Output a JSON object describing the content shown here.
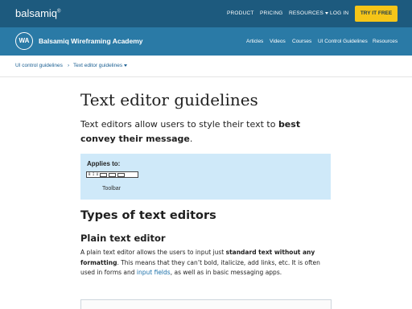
{
  "top_nav": {
    "brand": "balsamiq",
    "brand_mark": "®",
    "items": [
      {
        "label": "PRODUCT"
      },
      {
        "label": "PRICING"
      },
      {
        "label": "RESOURCES"
      },
      {
        "label": "LOG IN"
      }
    ],
    "cta": "TRY IT FREE"
  },
  "academy_bar": {
    "logo": "WA",
    "title": "Balsamiq Wireframing Academy",
    "items": [
      {
        "label": "Articles"
      },
      {
        "label": "Videos"
      },
      {
        "label": "Courses"
      },
      {
        "label": "UI Control Guidelines"
      },
      {
        "label": "Resources"
      }
    ]
  },
  "breadcrumb": {
    "items": [
      {
        "label": "UI control guidelines"
      },
      {
        "label": "Text editor guidelines"
      }
    ],
    "separator": "›"
  },
  "article": {
    "title": "Text editor guidelines",
    "intro_prefix": "Text editors allow users to style their text to ",
    "intro_bold": "best convey their message",
    "intro_suffix": ".",
    "applies_to": {
      "label": "Applies to:",
      "toolbar_glyphs": "B I U",
      "caption": "Toolbar"
    },
    "section_heading": "Types of text editors",
    "subsection_heading": "Plain text editor",
    "para": {
      "t1": "A plain text editor allows the users to input just ",
      "b1": "standard text without any formatting",
      "t2": ". This means that they can’t bold, italicize, add links, etc. It is often used in forms and ",
      "link": "input fields",
      "t3": ", as well as in basic messaging apps."
    }
  },
  "colors": {
    "top_bar": "#1d5a7e",
    "academy_bar": "#2a7aa6",
    "cta": "#f5c518",
    "applies_bg": "#cfe9f9",
    "link": "#1a6fa9"
  }
}
